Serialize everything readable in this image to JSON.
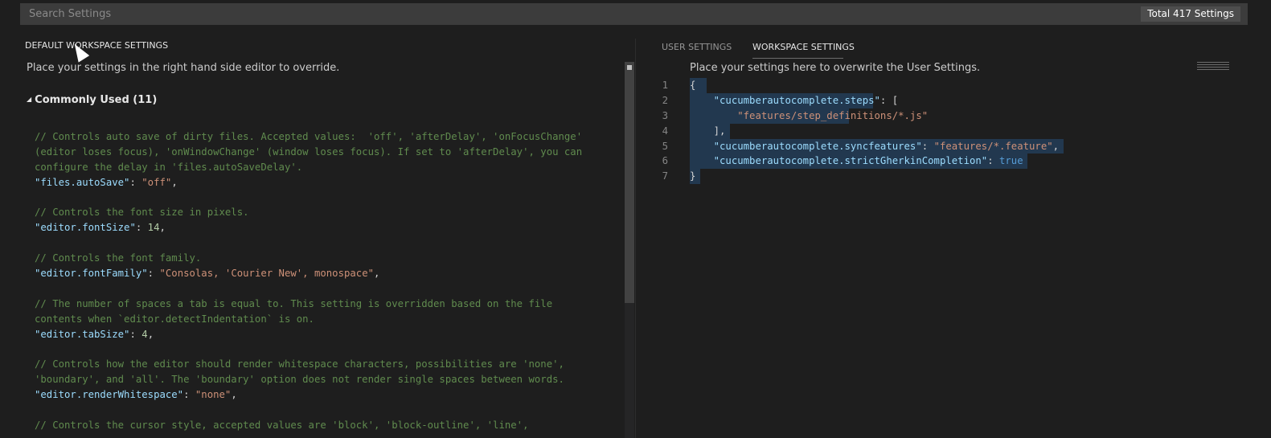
{
  "search": {
    "placeholder": "Search Settings",
    "count_label": "Total 417 Settings"
  },
  "default_panel": {
    "title": "DEFAULT WORKSPACE SETTINGS",
    "note": "Place your settings in the right hand side editor to override.",
    "group_label": "Commonly Used (11)",
    "code": [
      {
        "c": "// Controls auto save of dirty files. Accepted values:  'off', 'afterDelay', 'onFocusChange'"
      },
      {
        "c": "(editor loses focus), 'onWindowChange' (window loses focus). If set to 'afterDelay', you can"
      },
      {
        "c": "configure the delay in 'files.autoSaveDelay'."
      },
      {
        "k": "\"files.autoSave\"",
        "v": "\"off\"",
        "t": "str"
      },
      {},
      {
        "c": "// Controls the font size in pixels."
      },
      {
        "k": "\"editor.fontSize\"",
        "v": "14",
        "t": "num"
      },
      {},
      {
        "c": "// Controls the font family."
      },
      {
        "k": "\"editor.fontFamily\"",
        "v": "\"Consolas, 'Courier New', monospace\"",
        "t": "str"
      },
      {},
      {
        "c": "// The number of spaces a tab is equal to. This setting is overridden based on the file"
      },
      {
        "c": "contents when `editor.detectIndentation` is on."
      },
      {
        "k": "\"editor.tabSize\"",
        "v": "4",
        "t": "num"
      },
      {},
      {
        "c": "// Controls how the editor should render whitespace characters, possibilities are 'none',"
      },
      {
        "c": "'boundary', and 'all'. The 'boundary' option does not render single spaces between words."
      },
      {
        "k": "\"editor.renderWhitespace\"",
        "v": "\"none\"",
        "t": "str"
      },
      {},
      {
        "c": "// Controls the cursor style, accepted values are 'block', 'block-outline', 'line',"
      }
    ]
  },
  "settings_panel": {
    "tabs": [
      "USER SETTINGS",
      "WORKSPACE SETTINGS"
    ],
    "active_tab": "WORKSPACE SETTINGS",
    "note": "Place your settings here to overwrite the User Settings.",
    "lines": [
      {
        "n": "1",
        "parts": [
          [
            "punc",
            "{"
          ]
        ]
      },
      {
        "n": "2",
        "parts": [
          [
            "punc",
            "    "
          ],
          [
            "key",
            "\"cucumberautocomplete.steps\""
          ],
          [
            "punc",
            ": ["
          ]
        ]
      },
      {
        "n": "3",
        "parts": [
          [
            "punc",
            "        "
          ],
          [
            "str",
            "\"features/step_definitions/*.js\""
          ]
        ]
      },
      {
        "n": "4",
        "parts": [
          [
            "punc",
            "    ],"
          ]
        ]
      },
      {
        "n": "5",
        "parts": [
          [
            "punc",
            "    "
          ],
          [
            "key",
            "\"cucumberautocomplete.syncfeatures\""
          ],
          [
            "punc",
            ": "
          ],
          [
            "str",
            "\"features/*.feature\""
          ],
          [
            "punc",
            ","
          ]
        ]
      },
      {
        "n": "6",
        "parts": [
          [
            "punc",
            "    "
          ],
          [
            "key",
            "\"cucumberautocomplete.strictGherkinCompletion\""
          ],
          [
            "punc",
            ": "
          ],
          [
            "bool",
            "true"
          ]
        ]
      },
      {
        "n": "7",
        "parts": [
          [
            "punc",
            "}"
          ]
        ]
      }
    ]
  },
  "colors": {
    "background": "#1e1e1e",
    "comment": "#608b4e",
    "key": "#9cdcfe",
    "string": "#ce9178",
    "number": "#b5cea8",
    "boolean": "#569cd6"
  }
}
